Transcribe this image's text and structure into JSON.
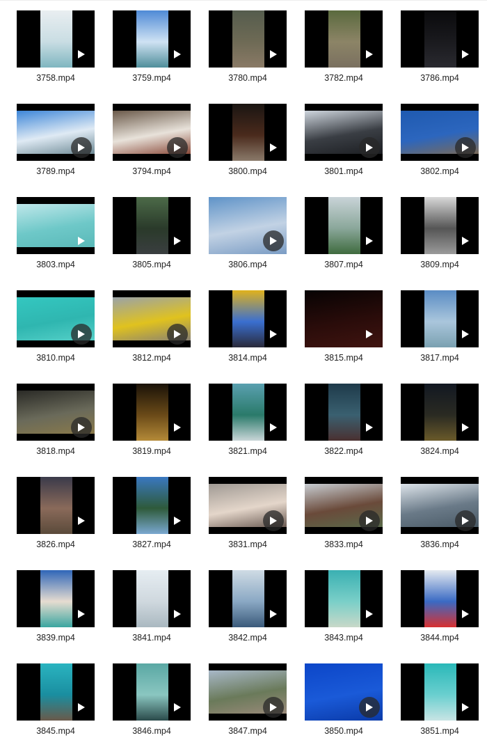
{
  "files": [
    {
      "name": "3758.mp4",
      "shape": "portrait",
      "colors": [
        "#e9eef1",
        "#c9dde3",
        "#7fb6c0"
      ],
      "play_style": "bare"
    },
    {
      "name": "3759.mp4",
      "shape": "portrait",
      "colors": [
        "#4f8ad6",
        "#cfe2f3",
        "#4f8e9a"
      ],
      "play_style": "bare"
    },
    {
      "name": "3780.mp4",
      "shape": "portrait",
      "colors": [
        "#555c4d",
        "#6e6a55",
        "#8a7a66"
      ],
      "play_style": "bare"
    },
    {
      "name": "3782.mp4",
      "shape": "portrait",
      "colors": [
        "#5a6a3e",
        "#8c8466",
        "#7a7060"
      ],
      "play_style": "bare"
    },
    {
      "name": "3786.mp4",
      "shape": "portrait",
      "colors": [
        "#0a0a0c",
        "#1a1a1e",
        "#2a2a30"
      ],
      "play_style": "bare"
    },
    {
      "name": "3789.mp4",
      "shape": "land",
      "colors": [
        "#3d86d8",
        "#dfeaf4",
        "#6e8a95"
      ],
      "play_style": "disc"
    },
    {
      "name": "3794.mp4",
      "shape": "land",
      "colors": [
        "#6b5a4a",
        "#e8e2da",
        "#8a4a3a"
      ],
      "play_style": "disc"
    },
    {
      "name": "3800.mp4",
      "shape": "portrait",
      "colors": [
        "#1a1512",
        "#4a2a1c",
        "#8a7a6a"
      ],
      "play_style": "bare"
    },
    {
      "name": "3801.mp4",
      "shape": "land",
      "colors": [
        "#cfd6de",
        "#3a3e44",
        "#1c1e22"
      ],
      "play_style": "disc"
    },
    {
      "name": "3802.mp4",
      "shape": "land",
      "colors": [
        "#1f5ab0",
        "#2c66be",
        "#7a6a58"
      ],
      "play_style": "disc"
    },
    {
      "name": "3803.mp4",
      "shape": "land",
      "colors": [
        "#bfe7ea",
        "#6ec8c8",
        "#5ab9b8"
      ],
      "play_style": "bare"
    },
    {
      "name": "3805.mp4",
      "shape": "portrait",
      "colors": [
        "#4c6a48",
        "#2a3a2a",
        "#3a3e40"
      ],
      "play_style": "bare"
    },
    {
      "name": "3806.mp4",
      "shape": "full",
      "colors": [
        "#5f93c8",
        "#c2d2e4",
        "#7a9cc4"
      ],
      "play_style": "disc"
    },
    {
      "name": "3807.mp4",
      "shape": "portrait",
      "colors": [
        "#c9d4d8",
        "#8aa79a",
        "#3f6b3e"
      ],
      "play_style": "bare"
    },
    {
      "name": "3809.mp4",
      "shape": "portrait",
      "colors": [
        "#d8d8d8",
        "#555555",
        "#9a9a9a"
      ],
      "play_style": "bare"
    },
    {
      "name": "3810.mp4",
      "shape": "land",
      "colors": [
        "#34c7c0",
        "#2fb6b0",
        "#55d0c8"
      ],
      "play_style": "disc"
    },
    {
      "name": "3812.mp4",
      "shape": "land",
      "colors": [
        "#9aa2a8",
        "#e0c21e",
        "#8a8272"
      ],
      "play_style": "disc"
    },
    {
      "name": "3814.mp4",
      "shape": "portrait",
      "colors": [
        "#e0b21c",
        "#3a6fd0",
        "#2a2a3a"
      ],
      "play_style": "bare"
    },
    {
      "name": "3815.mp4",
      "shape": "full",
      "colors": [
        "#070303",
        "#2a0c0a",
        "#401410"
      ],
      "play_style": "bare"
    },
    {
      "name": "3817.mp4",
      "shape": "portrait",
      "colors": [
        "#5a8cc4",
        "#aac6dc",
        "#7aa0b0"
      ],
      "play_style": "bare"
    },
    {
      "name": "3818.mp4",
      "shape": "land",
      "colors": [
        "#2a2a26",
        "#6a6a5a",
        "#8a7a4a"
      ],
      "play_style": "disc"
    },
    {
      "name": "3819.mp4",
      "shape": "portrait",
      "colors": [
        "#1a1208",
        "#6a4a18",
        "#b48a38"
      ],
      "play_style": "bare"
    },
    {
      "name": "3821.mp4",
      "shape": "portrait",
      "colors": [
        "#5aa0b0",
        "#2a7a6a",
        "#c9d6d8"
      ],
      "play_style": "bare"
    },
    {
      "name": "3822.mp4",
      "shape": "portrait",
      "colors": [
        "#1e3a4a",
        "#3a6070",
        "#4a3030"
      ],
      "play_style": "bare"
    },
    {
      "name": "3824.mp4",
      "shape": "portrait",
      "colors": [
        "#121822",
        "#2a2a22",
        "#6a5a2a"
      ],
      "play_style": "bare"
    },
    {
      "name": "3826.mp4",
      "shape": "portrait",
      "colors": [
        "#3a3a4a",
        "#8a6a5a",
        "#5a4a3a"
      ],
      "play_style": "bare"
    },
    {
      "name": "3827.mp4",
      "shape": "portrait",
      "colors": [
        "#3a78c0",
        "#2e5a3a",
        "#7aa8d0"
      ],
      "play_style": "bare"
    },
    {
      "name": "3831.mp4",
      "shape": "land",
      "colors": [
        "#a09a94",
        "#e4d6ca",
        "#6a5a52"
      ],
      "play_style": "disc"
    },
    {
      "name": "3833.mp4",
      "shape": "land",
      "colors": [
        "#c8cdd2",
        "#6a4a3a",
        "#5a6a4a"
      ],
      "play_style": "disc"
    },
    {
      "name": "3836.mp4",
      "shape": "land",
      "colors": [
        "#dde4ea",
        "#6a7a88",
        "#4a5a66"
      ],
      "play_style": "disc"
    },
    {
      "name": "3839.mp4",
      "shape": "portrait",
      "colors": [
        "#2f66b8",
        "#e6dcd0",
        "#3aa6a0"
      ],
      "play_style": "bare"
    },
    {
      "name": "3841.mp4",
      "shape": "portrait",
      "colors": [
        "#e6edf2",
        "#cfd8de",
        "#aab8c0"
      ],
      "play_style": "bare"
    },
    {
      "name": "3842.mp4",
      "shape": "portrait",
      "colors": [
        "#cfdbe4",
        "#8aa8c4",
        "#3a5a7a"
      ],
      "play_style": "bare"
    },
    {
      "name": "3843.mp4",
      "shape": "portrait",
      "colors": [
        "#3ab0b2",
        "#7acfc8",
        "#c8d8c8"
      ],
      "play_style": "bare"
    },
    {
      "name": "3844.mp4",
      "shape": "portrait",
      "colors": [
        "#e4eaf0",
        "#3a6ac4",
        "#d83030"
      ],
      "play_style": "bare"
    },
    {
      "name": "3845.mp4",
      "shape": "portrait",
      "colors": [
        "#2ab4c0",
        "#1a8ea0",
        "#6a5a4a"
      ],
      "play_style": "bare"
    },
    {
      "name": "3846.mp4",
      "shape": "portrait",
      "colors": [
        "#5aa8a4",
        "#8ac6c0",
        "#2a4a4a"
      ],
      "play_style": "bare"
    },
    {
      "name": "3847.mp4",
      "shape": "land",
      "colors": [
        "#a8b8c8",
        "#6a7a5a",
        "#9a8a7a"
      ],
      "play_style": "disc"
    },
    {
      "name": "3850.mp4",
      "shape": "full",
      "colors": [
        "#0c46c8",
        "#1a5ad8",
        "#0a3aa8"
      ],
      "play_style": "disc"
    },
    {
      "name": "3851.mp4",
      "shape": "portrait",
      "colors": [
        "#2ab8b8",
        "#6acfcf",
        "#c8e4e4"
      ],
      "play_style": "bare"
    }
  ],
  "icons": {
    "play": "play-icon"
  }
}
